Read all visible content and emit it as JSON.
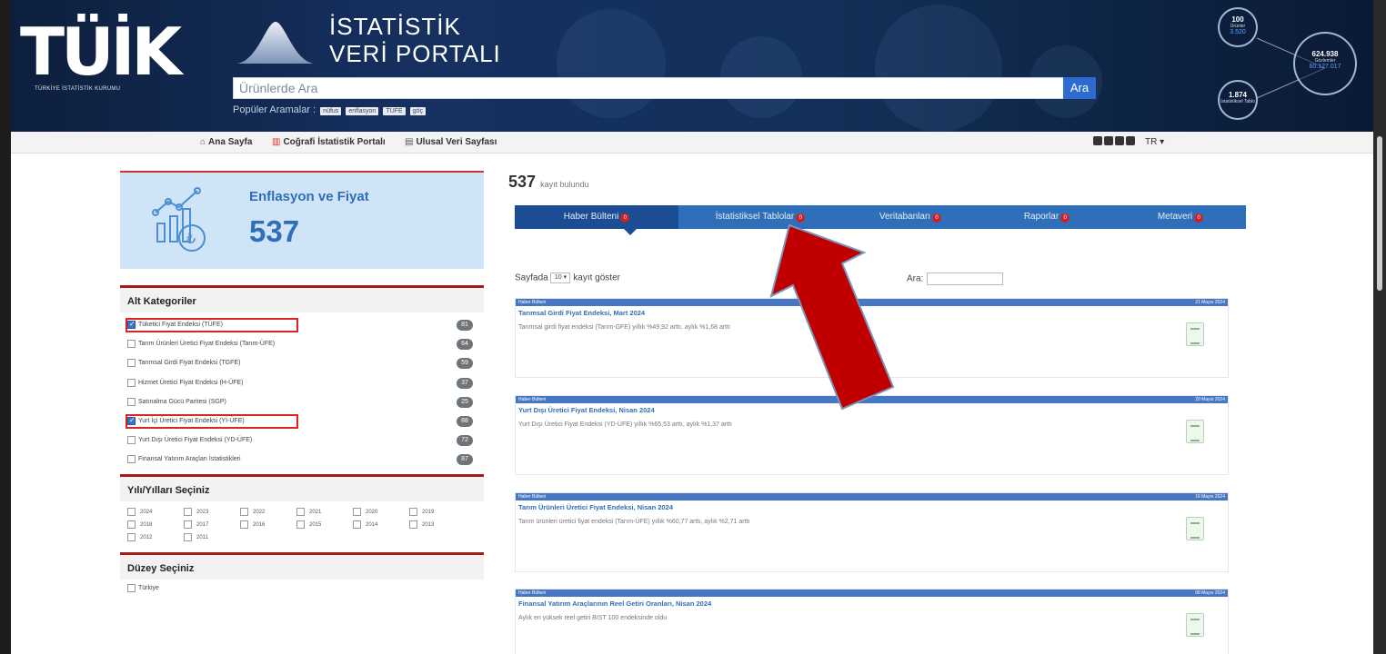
{
  "header": {
    "logo_text": "TÜİK",
    "logo_sub": "TÜRKİYE İSTATİSTİK KURUMU",
    "portal_title_1": "İSTATİSTİK",
    "portal_title_2": "VERİ PORTALI",
    "search_placeholder": "Ürünlerde Ara",
    "search_button": "Ara",
    "popular_label": "Popüler Aramalar :",
    "popular_tags": [
      "nüfus",
      "enflasyon",
      "TÜFE",
      "göç"
    ],
    "stats": [
      {
        "num": "100",
        "lbl": "Ürünler",
        "blue": "3.520"
      },
      {
        "num": "624.938",
        "lbl": "Gözlemler",
        "blue": "60.127.017"
      },
      {
        "num": "1.874",
        "lbl": "İstatistiksel Tablo",
        "blue": ""
      }
    ]
  },
  "topnav": {
    "home": "Ana Sayfa",
    "geo": "Coğrafi İstatistik Portalı",
    "national": "Ulusal Veri Sayfası",
    "lang": "TR ▾"
  },
  "category": {
    "title": "Enflasyon ve Fiyat",
    "count": "537"
  },
  "subcategories": {
    "heading": "Alt Kategoriler",
    "items": [
      {
        "label": "Tüketici Fiyat Endeksi (TÜFE)",
        "count": "81",
        "checked": true
      },
      {
        "label": "Tarım Ürünleri Üretici Fiyat Endeksi (Tarım-ÜFE)",
        "count": "64",
        "checked": false
      },
      {
        "label": "Tarımsal Girdi Fiyat Endeksi (TGFE)",
        "count": "59",
        "checked": false
      },
      {
        "label": "Hizmet Üretici Fiyat Endeksi (H-ÜFE)",
        "count": "37",
        "checked": false
      },
      {
        "label": "Satınalma Gücü Paritesi (SGP)",
        "count": "25",
        "checked": false
      },
      {
        "label": "Yurt İçi Üretici Fiyat Endeksi (Yİ-ÜFE)",
        "count": "88",
        "checked": true
      },
      {
        "label": "Yurt Dışı Üretici Fiyat Endeksi (YD-ÜFE)",
        "count": "72",
        "checked": false
      },
      {
        "label": "Finansal Yatırım Araçları İstatistikleri",
        "count": "87",
        "checked": false
      }
    ]
  },
  "years": {
    "heading": "Yılı/Yılları Seçiniz",
    "items": [
      "2024",
      "2023",
      "2022",
      "2021",
      "2020",
      "2019",
      "2018",
      "2017",
      "2016",
      "2015",
      "2014",
      "2013",
      "2012",
      "2011"
    ]
  },
  "level": {
    "heading": "Düzey Seçiniz",
    "items": [
      "Türkiye"
    ]
  },
  "results": {
    "count": "537",
    "found_label": "kayıt bulundu",
    "tabs": [
      {
        "label": "Haber Bülteni",
        "cnt": "0"
      },
      {
        "label": "İstatistiksel Tablolar",
        "cnt": "0"
      },
      {
        "label": "Veritabanları",
        "cnt": "0"
      },
      {
        "label": "Raporlar",
        "cnt": "0"
      },
      {
        "label": "Metaveri",
        "cnt": "0"
      }
    ],
    "show_prefix": "Sayfada",
    "show_value": "10 ▾",
    "show_suffix": "kayıt göster",
    "search_label": "Ara:",
    "news": [
      {
        "type": "Haber Bülteni",
        "date": "21 Mayıs 2024",
        "title": "Tarımsal Girdi Fiyat Endeksi, Mart 2024",
        "desc": "Tarımsal girdi fiyat endeksi (Tarım-GFE) yıllık %49,92 arttı, aylık %1,68 arttı"
      },
      {
        "type": "Haber Bülteni",
        "date": "20 Mayıs 2024",
        "title": "Yurt Dışı Üretici Fiyat Endeksi, Nisan 2024",
        "desc": "Yurt Dışı Üretici Fiyat Endeksi (YD-ÜFE) yıllık %65,53 arttı, aylık %1,37 arttı"
      },
      {
        "type": "Haber Bülteni",
        "date": "16 Mayıs 2024",
        "title": "Tarım Ürünleri Üretici Fiyat Endeksi, Nisan 2024",
        "desc": "Tarım ürünleri üretici fiyat endeksi (Tarım-ÜFE) yıllık %60,77 arttı, aylık %2,71 arttı"
      },
      {
        "type": "Haber Bülteni",
        "date": "08 Mayıs 2024",
        "title": "Finansal Yatırım Araçlarının Reel Getiri Oranları, Nisan 2024",
        "desc": "Aylık en yüksek reel getiri BIST 100 endeksinde oldu"
      }
    ]
  },
  "colors": {
    "accent_blue": "#2f6fb9",
    "highlight_red": "#d22222",
    "arrow_red": "#c00000"
  }
}
